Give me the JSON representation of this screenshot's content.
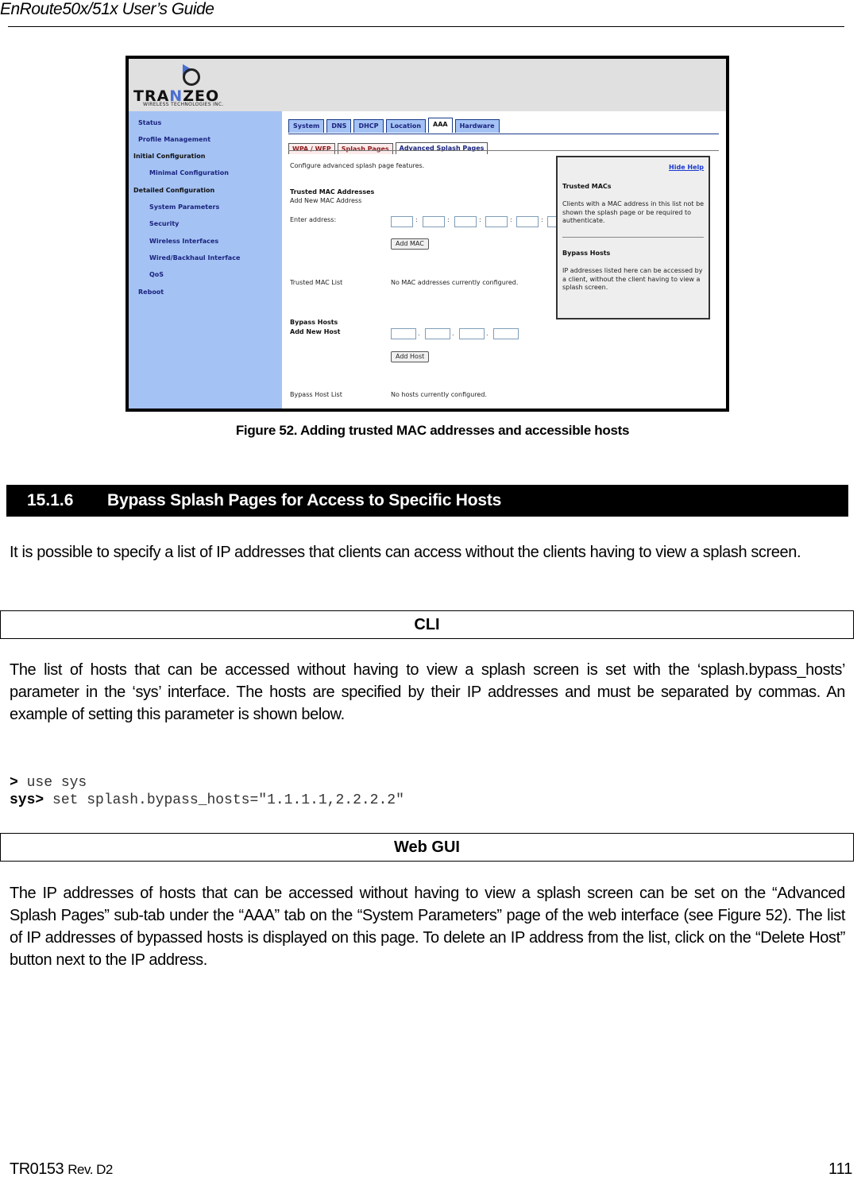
{
  "header": {
    "title": "EnRoute50x/51x User’s Guide"
  },
  "figure": {
    "logo": {
      "brand": "TRA",
      "brand_n": "N",
      "brand_rest": "ZEO",
      "subtitle": "WIRELESS TECHNOLOGIES INC."
    },
    "sidebar": {
      "items": [
        {
          "label": "Status"
        },
        {
          "label": "Profile Management"
        },
        {
          "label": "Initial Configuration"
        },
        {
          "label": "Minimal Configuration"
        },
        {
          "label": "Detailed Configuration"
        },
        {
          "label": "System Parameters"
        },
        {
          "label": "Security"
        },
        {
          "label": "Wireless Interfaces"
        },
        {
          "label": "Wired/Backhaul Interface"
        },
        {
          "label": "QoS"
        },
        {
          "label": "Reboot"
        }
      ]
    },
    "tabs": [
      {
        "label": "System"
      },
      {
        "label": "DNS"
      },
      {
        "label": "DHCP"
      },
      {
        "label": "Location"
      },
      {
        "label": "AAA",
        "active": true
      },
      {
        "label": "Hardware"
      }
    ],
    "subtabs": [
      {
        "label": "WPA / WEP"
      },
      {
        "label": "Splash Pages"
      },
      {
        "label": "Advanced Splash Pages",
        "active": true
      }
    ],
    "intro": "Configure advanced splash page features.",
    "trusted_mac": {
      "heading": "Trusted MAC Addresses",
      "subheading": "Add New MAC Address",
      "enter_label": "Enter address:",
      "separator": ":",
      "add_button": "Add MAC",
      "list_label": "Trusted MAC List",
      "list_value": "No MAC addresses currently configured."
    },
    "bypass": {
      "heading": "Bypass Hosts",
      "subheading": "Add New Host",
      "separator": ".",
      "add_button": "Add Host",
      "list_label": "Bypass Host List",
      "list_value": "No hosts currently configured."
    },
    "help": {
      "hide_link": "Hide Help",
      "trusted_heading": "Trusted MACs",
      "trusted_text": "Clients with a MAC address in this list not be shown the splash page or be required to authenticate.",
      "bypass_heading": "Bypass Hosts",
      "bypass_text": "IP addresses listed here can be accessed by a client, without the client having to view a splash screen."
    },
    "caption": "Figure 52. Adding trusted MAC addresses and accessible hosts"
  },
  "section": {
    "number": "15.1.6",
    "title": "Bypass Splash Pages for Access to Specific Hosts"
  },
  "intro_paragraph": "It is possible to specify a list of IP addresses that clients can access without the clients having to view a splash screen.",
  "cli": {
    "heading": "CLI",
    "paragraph": "The list of hosts that can be accessed without having to view a splash screen is set with the ‘splash.bypass_hosts’ parameter in the ‘sys’ interface. The hosts are specified by their IP addresses and must be separated by commas. An example of setting this parameter is shown below.",
    "lines": [
      {
        "prompt": ">",
        "command": " use sys"
      },
      {
        "prompt": "sys>",
        "command": " set splash.bypass_hosts=\"1.1.1.1,2.2.2.2\""
      }
    ]
  },
  "webgui": {
    "heading": "Web GUI",
    "paragraph": "The IP addresses of hosts that can be accessed without having to view a splash screen can be set on the “Advanced Splash Pages” sub-tab under the “AAA” tab on the “System Parameters” page of the web interface (see Figure 52). The list of IP addresses of bypassed hosts is displayed on this page. To delete an IP address from the list, click on the “Delete Host” button next to the IP address."
  },
  "footer": {
    "doc_id": "TR0153",
    "rev": "Rev. D2",
    "page": "111"
  }
}
